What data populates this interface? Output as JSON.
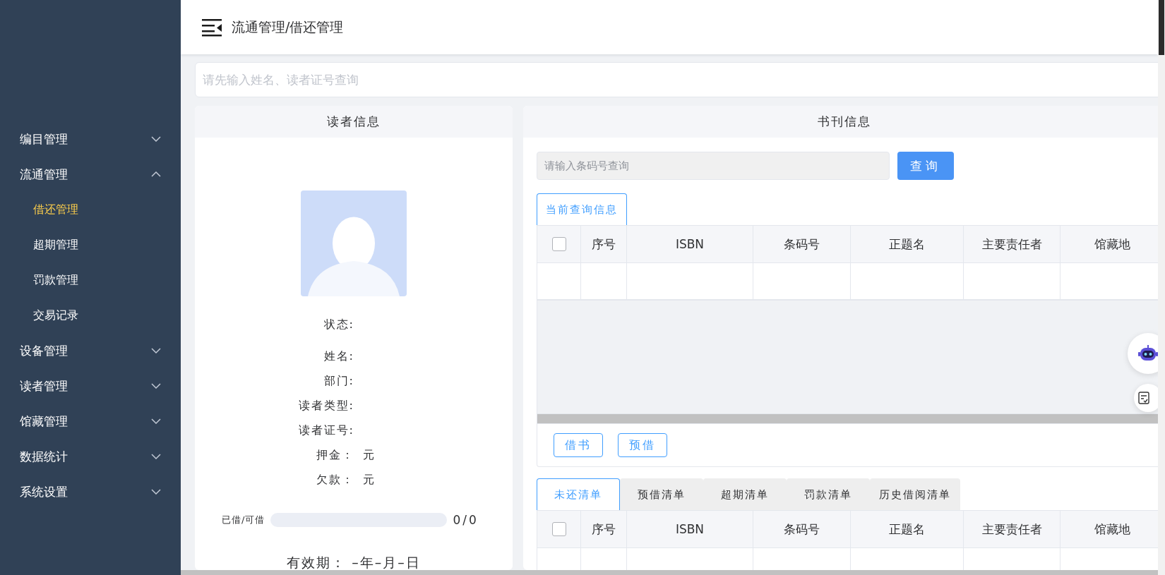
{
  "sidebar": {
    "items": [
      {
        "label": "编目管理",
        "expanded": false
      },
      {
        "label": "流通管理",
        "expanded": true,
        "children": [
          {
            "label": "借还管理",
            "selected": true
          },
          {
            "label": "超期管理",
            "selected": false
          },
          {
            "label": "罚款管理",
            "selected": false
          },
          {
            "label": "交易记录",
            "selected": false
          }
        ]
      },
      {
        "label": "设备管理",
        "expanded": false
      },
      {
        "label": "读者管理",
        "expanded": false
      },
      {
        "label": "馆藏管理",
        "expanded": false
      },
      {
        "label": "数据统计",
        "expanded": false
      },
      {
        "label": "系统设置",
        "expanded": false
      }
    ]
  },
  "header": {
    "breadcrumb": "流通管理/借还管理"
  },
  "reader_search": {
    "placeholder": "请先输入姓名、读者证号查询"
  },
  "reader_panel": {
    "title": "读者信息",
    "fields": [
      {
        "label": "状态:"
      },
      {
        "label": "姓名:"
      },
      {
        "label": "部门:"
      },
      {
        "label": "读者类型:"
      },
      {
        "label": "读者证号:"
      },
      {
        "label": "押金：",
        "value": "元"
      },
      {
        "label": "欠款：",
        "value": "元"
      }
    ],
    "loan": {
      "label": "已借/可借",
      "level": 0,
      "count": "0/0"
    },
    "validity": {
      "label": "有效期：",
      "value": "–年–月–日"
    }
  },
  "book_panel": {
    "title": "书刊信息",
    "barcode_search": {
      "placeholder": "请输入条码号查询",
      "disabled": true
    },
    "query_button": "查询",
    "tabs": [
      {
        "label": "当前查询信息",
        "selected": true
      }
    ],
    "table": {
      "select_all_checked": false,
      "columns": [
        "序号",
        "ISBN",
        "条码号",
        "正题名",
        "主要责任者",
        "馆藏地"
      ]
    },
    "actions": [
      "借书",
      "预借"
    ]
  },
  "lists": {
    "tabs": [
      {
        "label": "未还清单",
        "selected": true
      },
      {
        "label": "预借清单",
        "selected": false
      },
      {
        "label": "超期清单",
        "selected": false
      },
      {
        "label": "罚款清单",
        "selected": false
      },
      {
        "label": "历史借阅清单",
        "selected": false
      }
    ],
    "table": {
      "select_all_checked": false,
      "columns": [
        "序号",
        "ISBN",
        "条码号",
        "正题名",
        "主要责任者",
        "馆藏地"
      ]
    }
  }
}
